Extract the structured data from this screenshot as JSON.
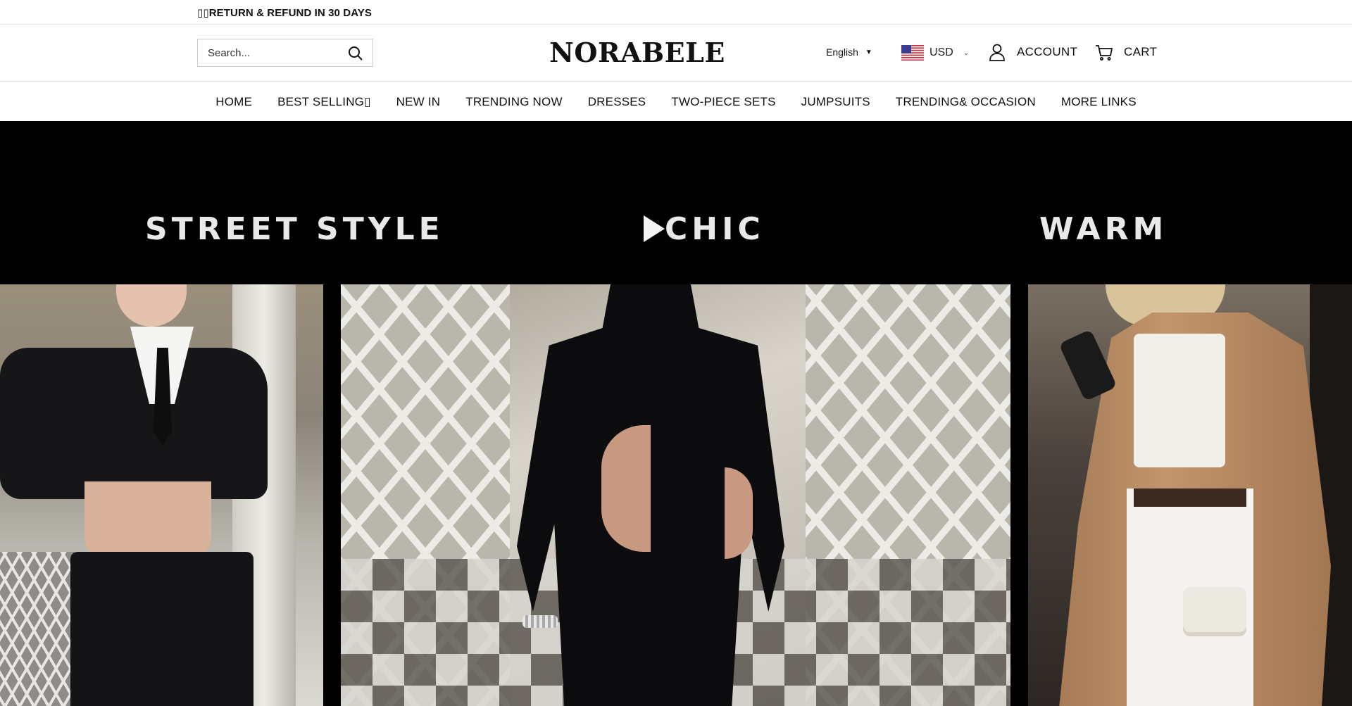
{
  "announcement": {
    "text": "▯▯RETURN & REFUND IN 30 DAYS"
  },
  "header": {
    "search_placeholder": "Search...",
    "logo": "NORABELE",
    "language": "English",
    "currency": "USD",
    "account_label": "ACCOUNT",
    "cart_label": "CART"
  },
  "nav": {
    "items": [
      "HOME",
      "BEST SELLING▯",
      "NEW IN",
      "TRENDING NOW",
      "DRESSES",
      "TWO-PIECE SETS",
      "JUMPSUITS",
      "TRENDING& OCCASION",
      "MORE LINKS"
    ]
  },
  "hero": {
    "labels": [
      "STREET STYLE",
      "CHIC",
      "WARM"
    ],
    "icons": {
      "play": "play-icon"
    }
  },
  "colors": {
    "hero_background": "#000000",
    "label_text": "#e9e9e9",
    "text": "#111111"
  }
}
